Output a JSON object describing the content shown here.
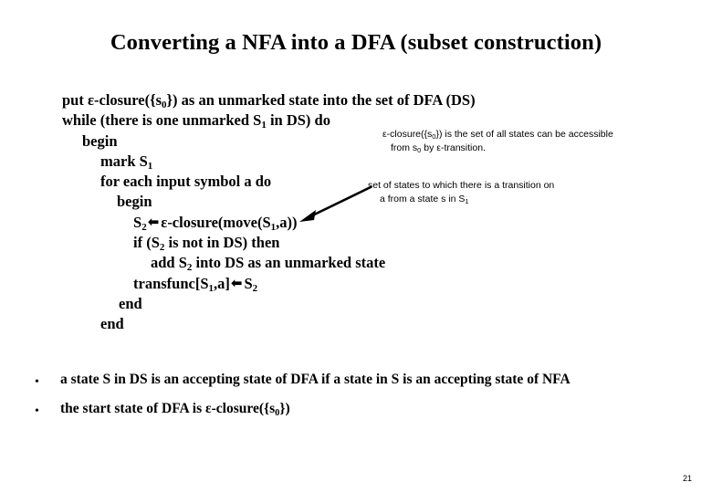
{
  "slide": {
    "title": "Converting a NFA into a DFA (subset construction)",
    "page_number": "21",
    "background_color": "#ffffff",
    "text_color": "#000000"
  },
  "algorithm": {
    "lines": [
      {
        "id": "line-put",
        "indent": 0,
        "text": "put  ε-closure({s",
        "sub": "0",
        "text_after": "}) as an unmarked  state into the set of DFA (DS)"
      },
      {
        "id": "line-while",
        "indent": 0,
        "text": "while (there is one unmarked S",
        "sub": "1",
        "text_after": " in DS) do"
      },
      {
        "id": "line-begin-outer",
        "indent": 1,
        "text": "begin",
        "sub": "",
        "text_after": ""
      },
      {
        "id": "line-mark",
        "indent": 2,
        "text": "mark S",
        "sub": "1",
        "text_after": ""
      },
      {
        "id": "line-for",
        "indent": 2,
        "text": "for each input symbol a do",
        "sub": "",
        "text_after": ""
      },
      {
        "id": "line-begin-inner",
        "indent": 3,
        "text": "begin",
        "sub": "",
        "text_after": ""
      },
      {
        "id": "line-assign-s2",
        "indent": 4,
        "text": "S",
        "sub": "2",
        "text_after": " ⬅ ε-closure(move(S₁,a))"
      },
      {
        "id": "line-if",
        "indent": 4,
        "text": "if (S",
        "sub": "2",
        "text_after": " is not in DS) then"
      },
      {
        "id": "line-add",
        "indent": 5,
        "text": "add S",
        "sub": "2",
        "text_after": " into DS as an unmarked state"
      },
      {
        "id": "line-transfunc",
        "indent": 4,
        "text": "transfunc[S",
        "sub": "1",
        "text_after": ",a] ⬅ S₂"
      },
      {
        "id": "line-end-inner",
        "indent": 0,
        "text": "end",
        "sub": "",
        "text_after": ""
      },
      {
        "id": "line-end-outer",
        "indent": 0,
        "text": "end",
        "sub": "",
        "text_after": ""
      }
    ],
    "line_put_a": "put  ε-closure({s",
    "line_put_sub": "0",
    "line_put_b": "}) as an unmarked  state into the set of DFA (DS)",
    "line_while_a": "while (there is one unmarked S",
    "line_while_sub": "1",
    "line_while_b": " in DS) do",
    "line_begin_outer": "begin",
    "line_mark_a": "mark S",
    "line_mark_sub": "1",
    "line_for": "for each input symbol a do",
    "line_begin_inner": "begin",
    "line_s2_a": "S",
    "line_s2_sub": "2",
    "line_s2_arrow": "⬅",
    "line_s2_b": "ε-closure(move(S",
    "line_s2_sub2": "1",
    "line_s2_c": ",a))",
    "line_if_a": "if (S",
    "line_if_sub": "2",
    "line_if_b": " is not in DS) then",
    "line_add_a": "add S",
    "line_add_sub": "2",
    "line_add_b": " into DS as an unmarked state",
    "line_tf_a": "transfunc[S",
    "line_tf_sub": "1",
    "line_tf_b": ",a]",
    "line_tf_arrow": "⬅",
    "line_tf_c": "S",
    "line_tf_sub2": "2",
    "line_end_inner": "end",
    "line_end_outer": "end"
  },
  "annotations": {
    "closure": {
      "line1_a": "ε-closure({s",
      "line1_sub": "0",
      "line1_b": "}) is the set of all states can be accessible",
      "line2_a": "from s",
      "line2_sub": "0",
      "line2_b": " by ε-transition."
    },
    "move": {
      "line1": "set of states to which there is a transition on",
      "line2_a": " a from a state s in S",
      "line2_sub": "1"
    }
  },
  "bullets": [
    {
      "marker": "•",
      "text_a": "a state S in DS is an accepting state of DFA if  a state in S is an accepting state of NFA",
      "sub": "",
      "text_b": ""
    },
    {
      "marker": "•",
      "text_a": "the start state of DFA is ε-closure({s",
      "sub": "0",
      "text_b": "})"
    }
  ],
  "bullet1_marker": "•",
  "bullet1_text": "a state S in DS is an accepting state of DFA if  a state in S is an accepting state of NFA",
  "bullet2_marker": "•",
  "bullet2_text_a": "the start state of DFA is ε-closure({s",
  "bullet2_sub": "0",
  "bullet2_text_b": "})"
}
